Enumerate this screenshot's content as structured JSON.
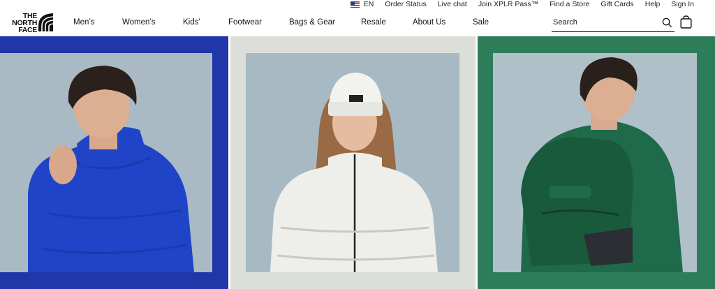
{
  "header": {
    "brand": "THE NORTH FACE",
    "logo_lines": [
      "THE",
      "NORTH",
      "FACE"
    ],
    "utility": {
      "language": "EN",
      "links": [
        "Order Status",
        "Live chat",
        "Join XPLR Pass™",
        "Find a Store",
        "Gift Cards",
        "Help",
        "Sign In"
      ]
    },
    "nav": [
      "Men’s",
      "Women’s",
      "Kids’",
      "Footwear",
      "Bags & Gear",
      "Resale",
      "About Us",
      "Sale"
    ],
    "search": {
      "placeholder": "Search",
      "value": ""
    },
    "icons": {
      "search": "search-icon",
      "bag": "shopping-bag-icon",
      "flag": "us-flag-icon"
    }
  },
  "hero": {
    "panels": [
      {
        "name": "mens-jacket",
        "frame_color": "#2136a8",
        "bg_color": "#a9bac4",
        "jacket_color": "#1f44c8"
      },
      {
        "name": "womens-jacket",
        "frame_color": "#dcdfd9",
        "bg_color": "#a7bac4",
        "jacket_color": "#eeeeea"
      },
      {
        "name": "backpack",
        "frame_color": "#2e7d5a",
        "bg_color": "#b0c0c8",
        "jacket_color": "#1e6a4a"
      }
    ]
  }
}
